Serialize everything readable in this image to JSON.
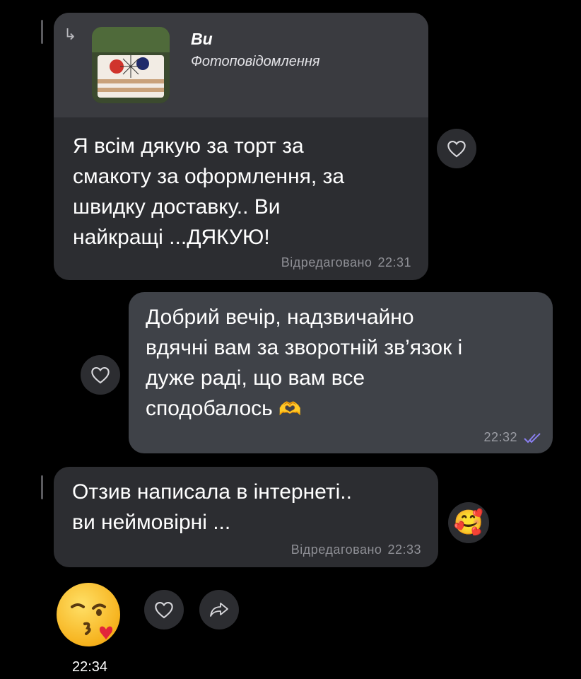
{
  "messages": [
    {
      "reply": {
        "name": "Ви",
        "subtitle": "Фотоповідомлення"
      },
      "text": "Я всім дякую за торт за\nсмакоту за оформлення, за\nшвидку доставку.. Ви\nнайкращі ...ДЯКУЮ!",
      "edited": "Відредаговано",
      "time": "22:31"
    },
    {
      "text": "Добрий вечір, надзвичайно\nвдячні вам за зворотній зв’язок і\nдуже раді, що вам все\nсподобалось",
      "emoji": "🫶",
      "time": "22:32",
      "status_icon": "double-check-icon"
    },
    {
      "text": "Отзив написала в інтернеті..\nви неймовірні ...",
      "edited": "Відредаговано",
      "time": "22:33",
      "reaction": "🥰"
    },
    {
      "emoji": "😘",
      "time": "22:34"
    }
  ],
  "colors": {
    "background": "#000000",
    "incoming_bubble": "#2c2d31",
    "outgoing_bubble": "#3f4248",
    "meta_text": "#8f9096",
    "read_check": "#8a7ff0"
  }
}
